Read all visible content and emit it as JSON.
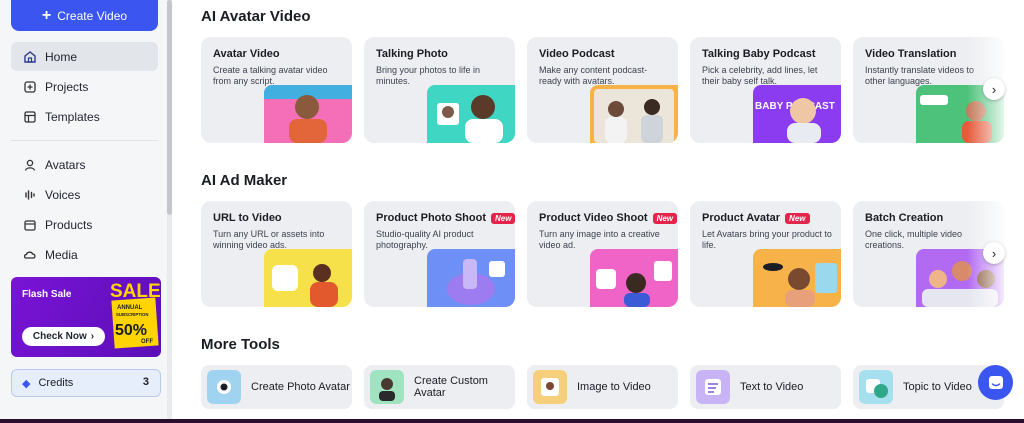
{
  "sidebar": {
    "create_label": "Create Video",
    "nav": [
      {
        "label": "Home",
        "icon": "home-icon"
      },
      {
        "label": "Projects",
        "icon": "projects-icon"
      },
      {
        "label": "Templates",
        "icon": "templates-icon"
      },
      {
        "label": "Avatars",
        "icon": "avatars-icon"
      },
      {
        "label": "Voices",
        "icon": "voices-icon"
      },
      {
        "label": "Products",
        "icon": "products-icon"
      },
      {
        "label": "Media",
        "icon": "media-icon"
      }
    ],
    "promo": {
      "title": "Flash Sale",
      "cta": "Check Now",
      "art_line1": "SALE",
      "art_line2": "ANNUAL",
      "art_line3": "SUBSCRIPTION",
      "art_line4": "50%",
      "art_line5": "OFF"
    },
    "credits": {
      "label": "Credits",
      "value": "3"
    }
  },
  "sections": {
    "avatar_video": {
      "title": "AI Avatar Video",
      "cards": [
        {
          "title": "Avatar Video",
          "desc": "Create a talking avatar video from any script."
        },
        {
          "title": "Talking Photo",
          "desc": "Bring your photos to life in minutes."
        },
        {
          "title": "Video Podcast",
          "desc": "Make any content podcast-ready with avatars."
        },
        {
          "title": "Talking Baby Podcast",
          "desc": "Pick a celebrity, add lines, let their baby self talk.",
          "art_text": "BABY PODCAST"
        },
        {
          "title": "Video Translation",
          "desc": "Instantly translate videos to other languages."
        }
      ]
    },
    "ad_maker": {
      "title": "AI Ad Maker",
      "new_badge": "New",
      "cards": [
        {
          "title": "URL to Video",
          "desc": "Turn any URL or assets into winning video ads."
        },
        {
          "title": "Product Photo Shoot",
          "desc": "Studio-quality AI product photography."
        },
        {
          "title": "Product Video Shoot",
          "desc": "Turn any image into a creative video ad."
        },
        {
          "title": "Product Avatar",
          "desc": "Let Avatars bring your product to life."
        },
        {
          "title": "Batch Creation",
          "desc": "One click, multiple video creations."
        }
      ]
    },
    "more_tools": {
      "title": "More Tools",
      "tools": [
        {
          "label": "Create Photo Avatar"
        },
        {
          "label": "Create Custom Avatar"
        },
        {
          "label": "Image to Video"
        },
        {
          "label": "Text to Video"
        },
        {
          "label": "Topic to Video"
        }
      ]
    }
  },
  "colors": {
    "accent": "#3a55f0",
    "new_badge": "#e5234b",
    "promo": "#6a12c7"
  }
}
